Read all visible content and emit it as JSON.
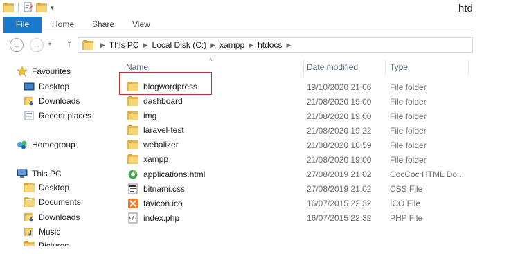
{
  "window": {
    "title": "htdocs"
  },
  "ribbon": {
    "file_tab": "File",
    "tabs": [
      "Home",
      "Share",
      "View"
    ]
  },
  "address": {
    "crumbs": [
      "This PC",
      "Local Disk (C:)",
      "xampp",
      "htdocs"
    ]
  },
  "navpane": {
    "favourites_label": "Favourites",
    "favourites": [
      "Desktop",
      "Downloads",
      "Recent places"
    ],
    "homegroup_label": "Homegroup",
    "thispc_label": "This PC",
    "thispc": [
      "Desktop",
      "Documents",
      "Downloads",
      "Music",
      "Pictures"
    ]
  },
  "columns": {
    "name": "Name",
    "date": "Date modified",
    "type": "Type"
  },
  "files": [
    {
      "name": "blogwordpress",
      "date": "19/10/2020 21:06",
      "type": "File folder",
      "icon": "folder-icon"
    },
    {
      "name": "dashboard",
      "date": "21/08/2020 19:00",
      "type": "File folder",
      "icon": "folder-icon"
    },
    {
      "name": "img",
      "date": "21/08/2020 19:00",
      "type": "File folder",
      "icon": "folder-icon"
    },
    {
      "name": "laravel-test",
      "date": "21/08/2020 19:22",
      "type": "File folder",
      "icon": "folder-icon"
    },
    {
      "name": "webalizer",
      "date": "21/08/2020 18:59",
      "type": "File folder",
      "icon": "folder-icon"
    },
    {
      "name": "xampp",
      "date": "21/08/2020 19:00",
      "type": "File folder",
      "icon": "folder-icon"
    },
    {
      "name": "applications.html",
      "date": "27/08/2019 21:02",
      "type": "CocCoc HTML Do...",
      "icon": "browser-html-icon"
    },
    {
      "name": "bitnami.css",
      "date": "27/08/2019 21:02",
      "type": "CSS File",
      "icon": "css-file-icon"
    },
    {
      "name": "favicon.ico",
      "date": "16/07/2015 22:32",
      "type": "ICO File",
      "icon": "xampp-ico-icon"
    },
    {
      "name": "index.php",
      "date": "16/07/2015 22:32",
      "type": "PHP File",
      "icon": "php-file-icon"
    }
  ],
  "colors": {
    "file_tab": "#1979ca",
    "highlight_box": "#d12b2b",
    "folder": "#f6d478"
  }
}
